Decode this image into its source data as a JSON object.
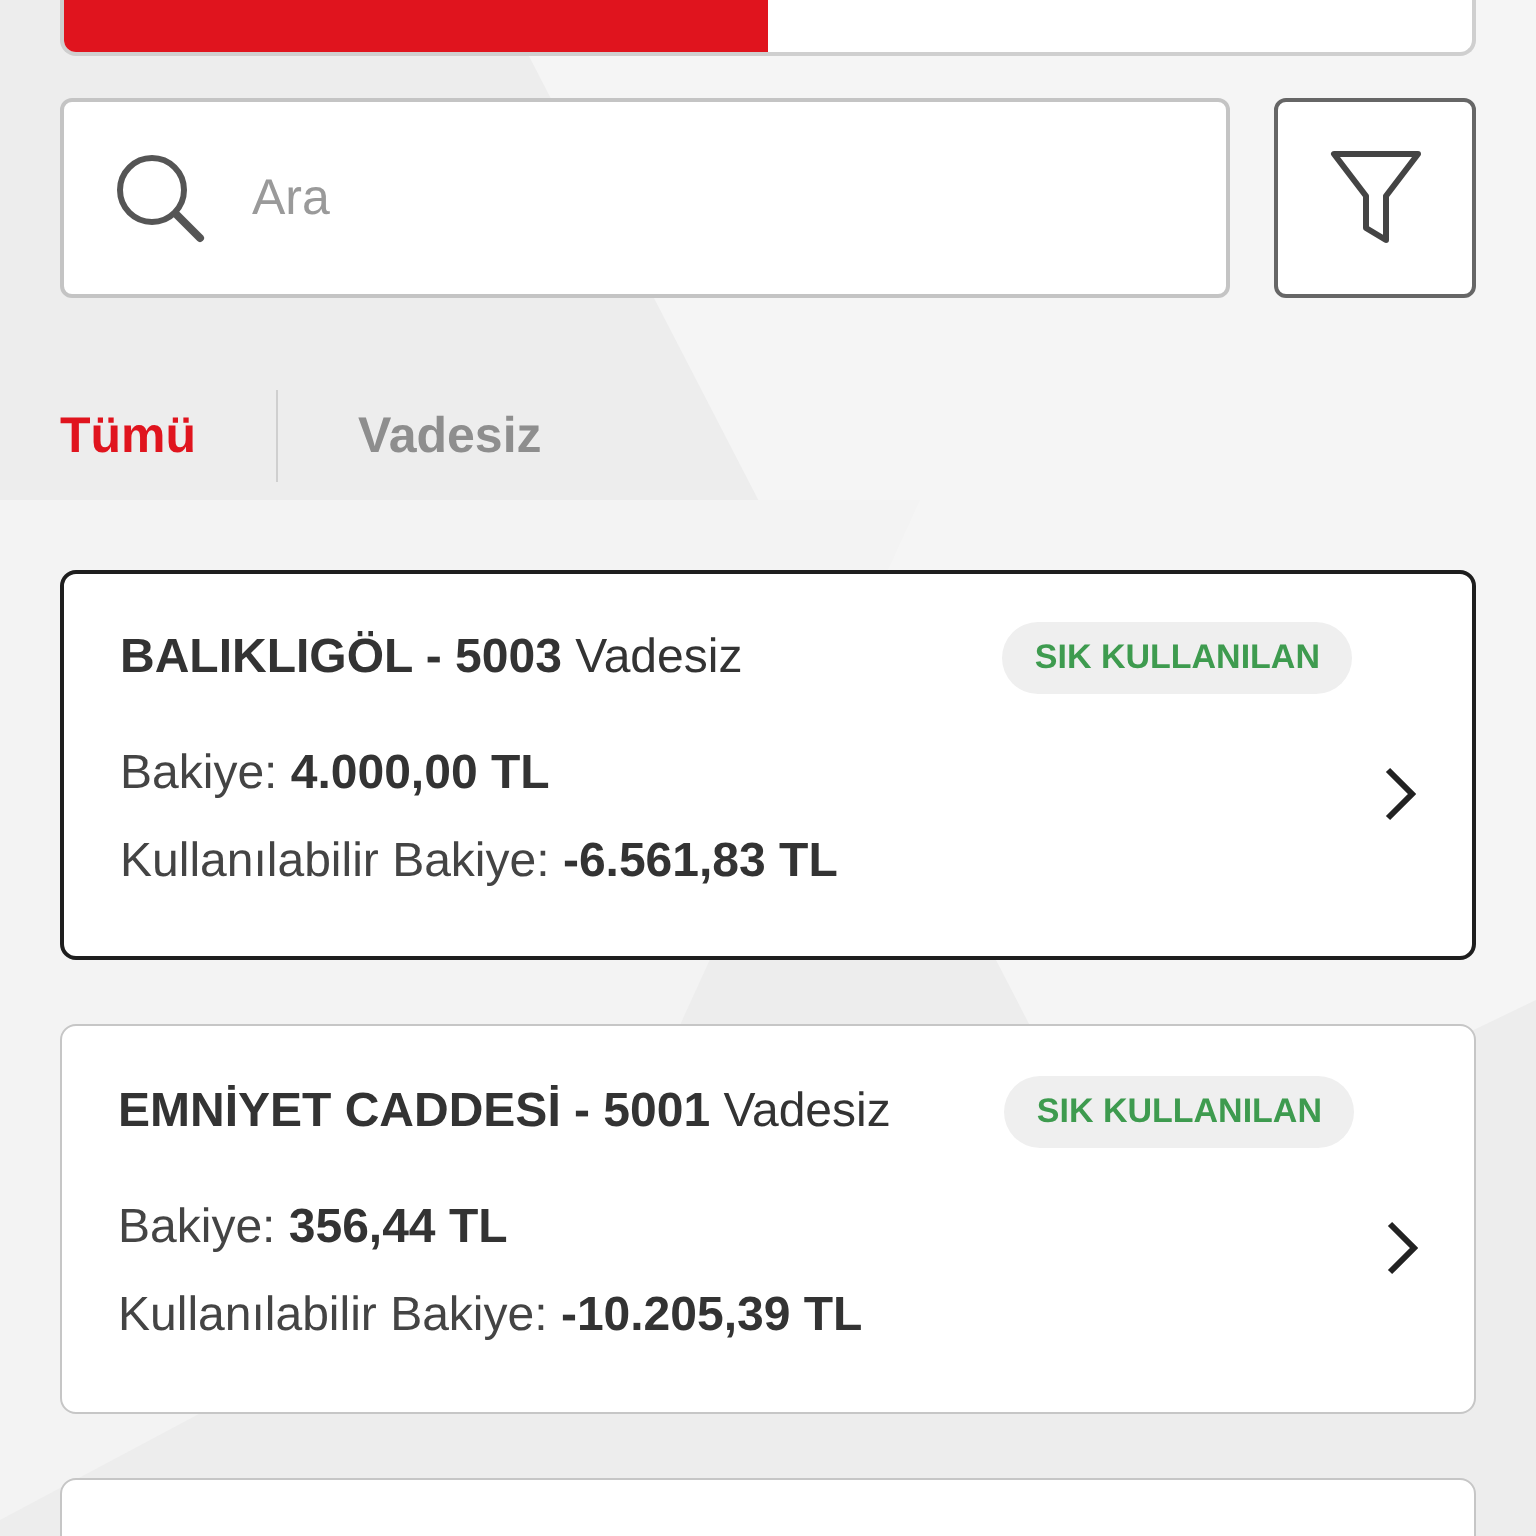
{
  "progress": {
    "level": 0.5
  },
  "search": {
    "placeholder": "Ara"
  },
  "tabs": [
    {
      "label": "Tümü",
      "selected": true
    },
    {
      "label": "Vadesiz",
      "selected": false
    }
  ],
  "accounts": [
    {
      "name": "BALIKLIGÖL - 5003",
      "type": "Vadesiz",
      "badge": "SIK KULLANILAN",
      "selected": true,
      "balance_label": "Bakiye:",
      "balance": "4.000,00 TL",
      "available_label": "Kullanılabilir Bakiye:",
      "available": "-6.561,83 TL"
    },
    {
      "name": "EMNİYET CADDESİ - 5001",
      "type": "Vadesiz",
      "badge": "SIK KULLANILAN",
      "selected": false,
      "balance_label": "Bakiye:",
      "balance": "356,44 TL",
      "available_label": "Kullanılabilir Bakiye:",
      "available": "-10.205,39 TL"
    }
  ]
}
